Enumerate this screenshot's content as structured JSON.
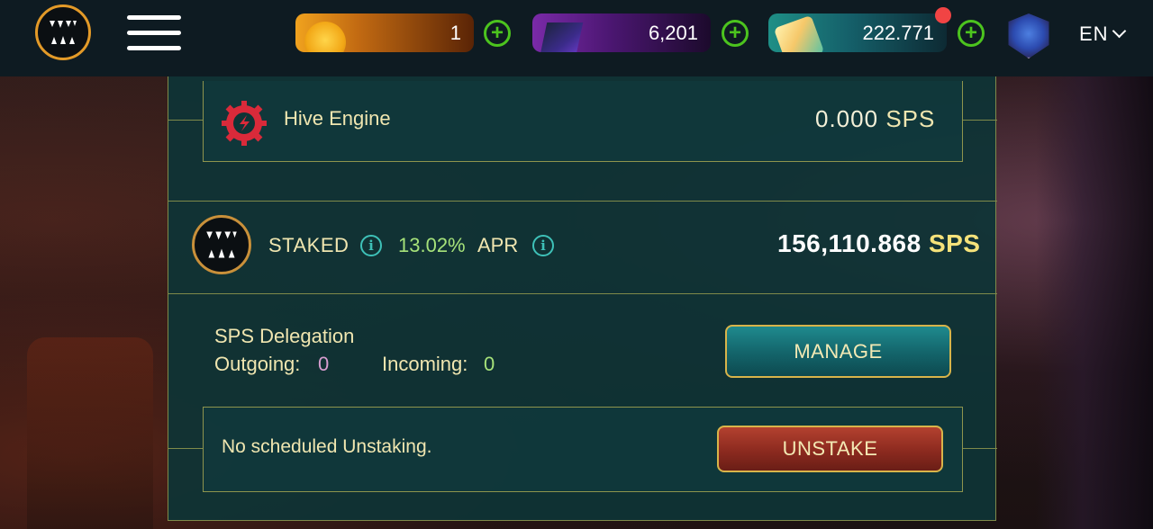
{
  "topbar": {
    "currencies": [
      {
        "name": "gold-coin",
        "value": "1",
        "color": "#f0a21e"
      },
      {
        "name": "dark-crystal",
        "value": "6,201",
        "color": "#7a2aa8"
      },
      {
        "name": "shard",
        "value": "222.771",
        "color": "#1e8f86"
      }
    ],
    "language": "EN"
  },
  "hive": {
    "label": "Hive Engine",
    "value": "0.000",
    "unit": "SPS"
  },
  "staked": {
    "label": "STAKED",
    "apr_pct": "13.02%",
    "apr_label": "APR",
    "value": "156,110.868",
    "unit": "SPS"
  },
  "delegation": {
    "title": "SPS Delegation",
    "outgoing_label": "Outgoing:",
    "outgoing_value": "0",
    "incoming_label": "Incoming:",
    "incoming_value": "0",
    "manage_label": "MANAGE"
  },
  "unstaking": {
    "status": "No scheduled Unstaking.",
    "button_label": "UNSTAKE"
  },
  "colors": {
    "accent_gold": "#d8b44a",
    "panel_teal": "#0e3436",
    "plus_green": "#4cc41e",
    "danger_red": "#8c2a1f"
  }
}
